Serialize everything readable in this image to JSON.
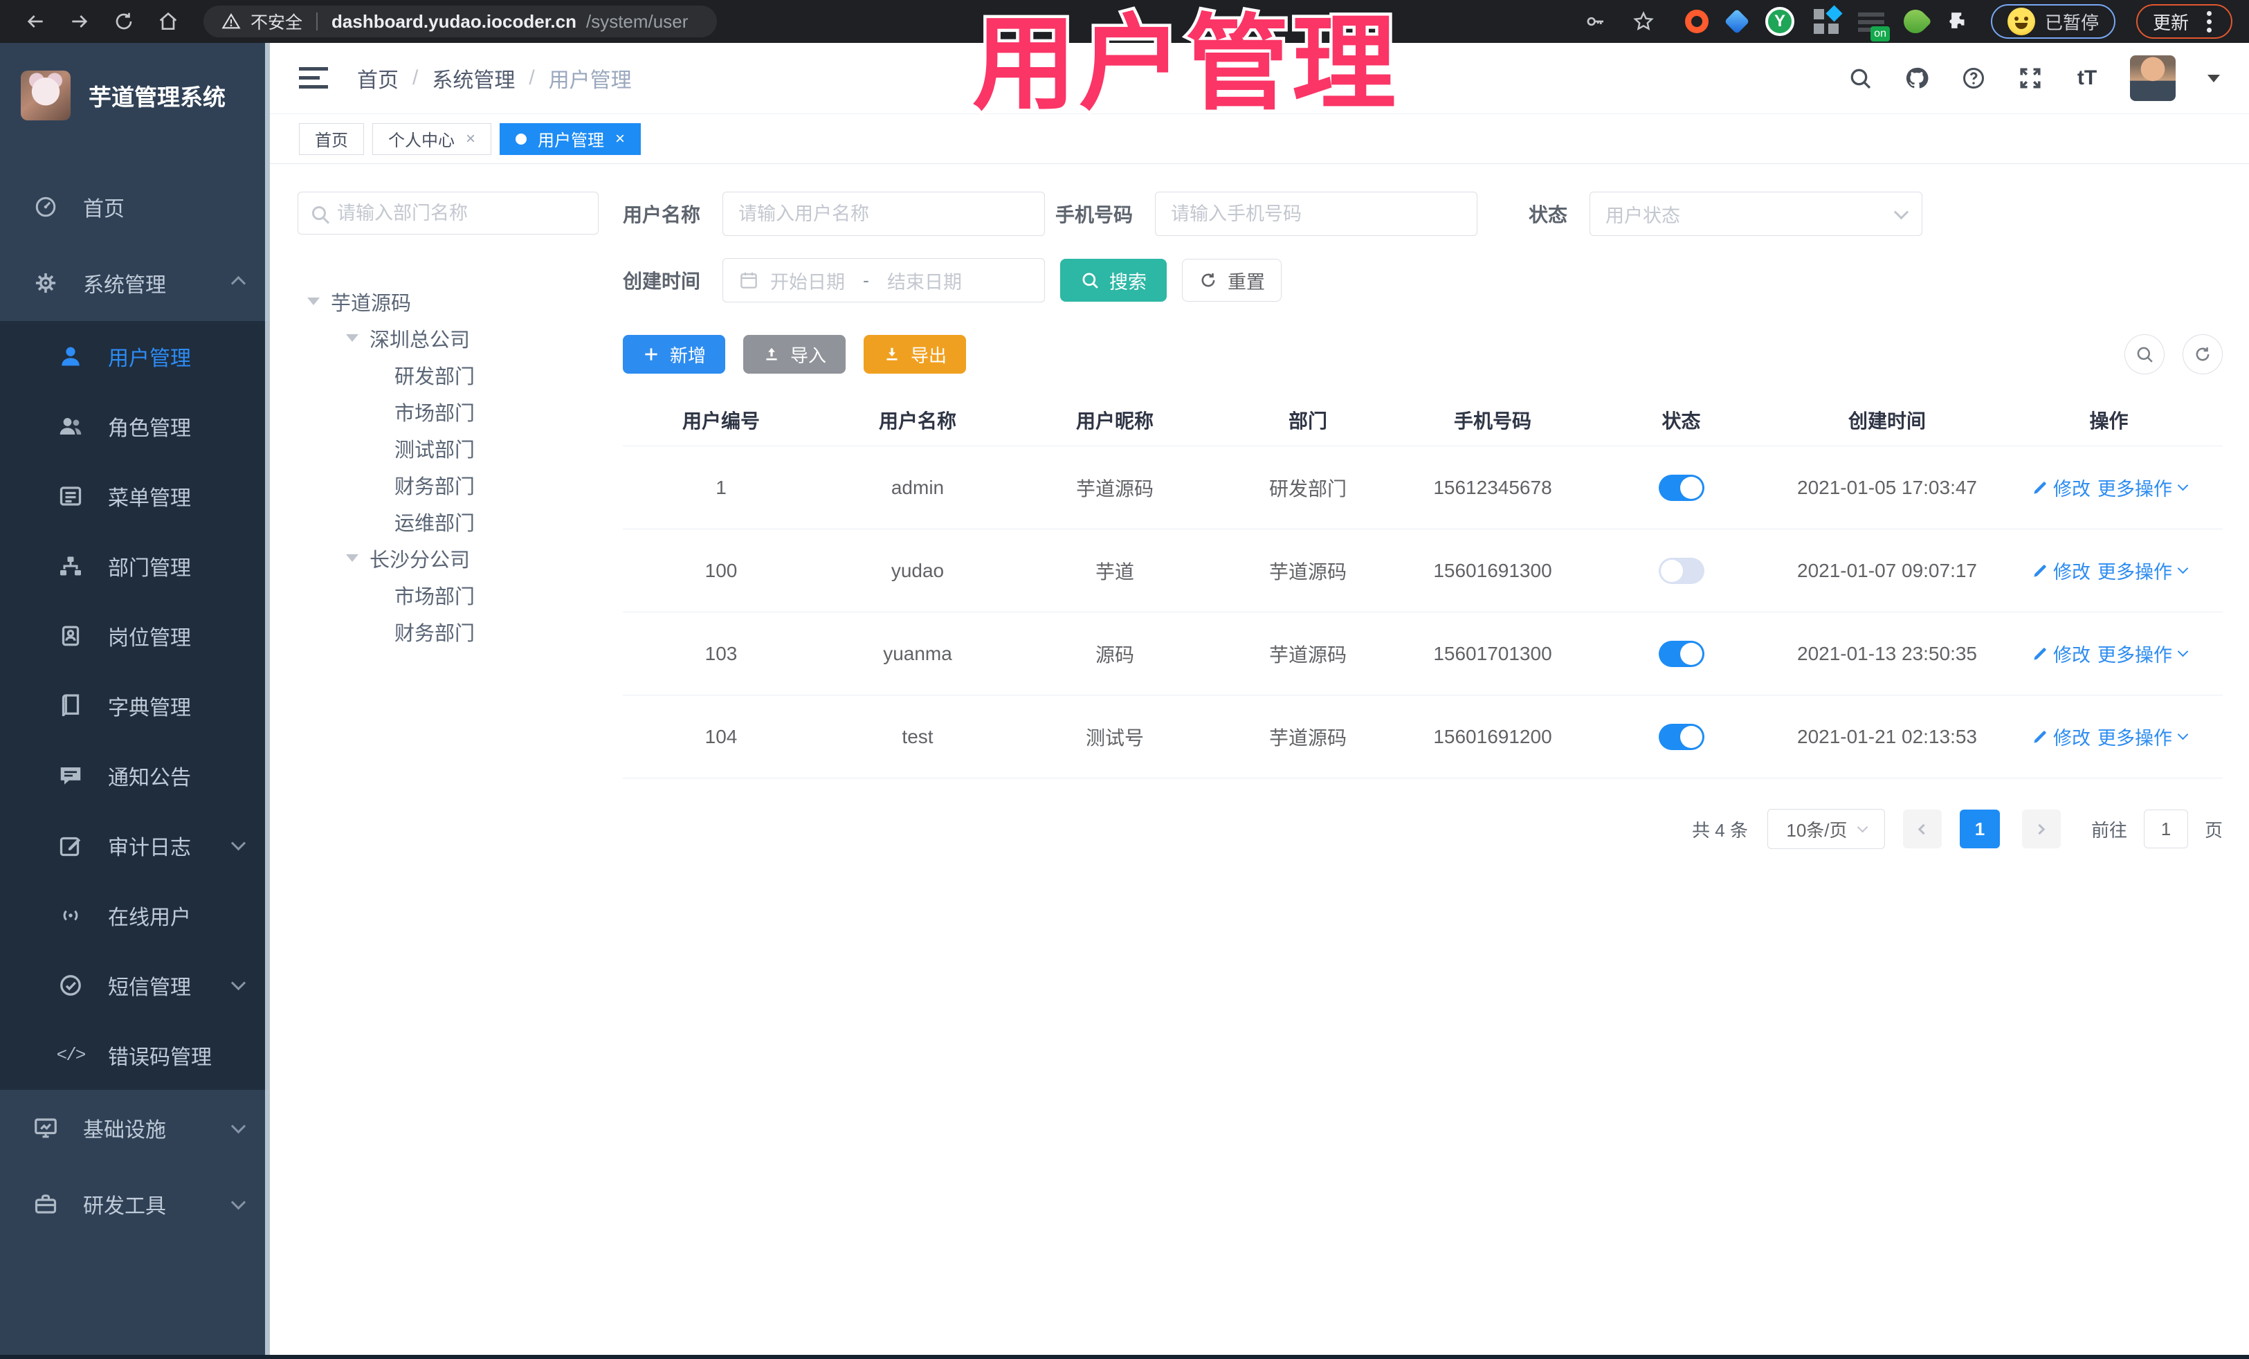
{
  "colors": {
    "primary": "#1d8cf5",
    "sidebar_bg": "#304156",
    "submenu_bg": "#1f2d3d",
    "teal_search": "#2db7a5",
    "export_orange": "#f0a020",
    "import_gray": "#909399",
    "overlay_pink": "#fb3566",
    "chrome_bg": "#1e2023"
  },
  "browser": {
    "security": "不安全",
    "url_host": "dashboard.yudao.iocoder.cn",
    "url_path": "/system/user",
    "paused": "已暂停",
    "update": "更新"
  },
  "overlay": {
    "title": "用户管理"
  },
  "sidebar": {
    "app_title": "芋道管理系统",
    "items": [
      {
        "label": "首页"
      },
      {
        "label": "系统管理"
      },
      {
        "label": "用户管理"
      },
      {
        "label": "角色管理"
      },
      {
        "label": "菜单管理"
      },
      {
        "label": "部门管理"
      },
      {
        "label": "岗位管理"
      },
      {
        "label": "字典管理"
      },
      {
        "label": "通知公告"
      },
      {
        "label": "审计日志"
      },
      {
        "label": "在线用户"
      },
      {
        "label": "短信管理"
      },
      {
        "label": "错误码管理"
      },
      {
        "label": "基础设施"
      },
      {
        "label": "研发工具"
      }
    ]
  },
  "header": {
    "breadcrumb": {
      "home": "首页",
      "section": "系统管理",
      "current": "用户管理",
      "separator": "/"
    }
  },
  "tabs": {
    "home": "首页",
    "profile": "个人中心",
    "user": "用户管理"
  },
  "dept": {
    "search_placeholder": "请输入部门名称",
    "tree": [
      {
        "label": "芋道源码"
      },
      {
        "label": "深圳总公司"
      },
      {
        "label": "研发部门"
      },
      {
        "label": "市场部门"
      },
      {
        "label": "测试部门"
      },
      {
        "label": "财务部门"
      },
      {
        "label": "运维部门"
      },
      {
        "label": "长沙分公司"
      },
      {
        "label": "市场部门"
      },
      {
        "label": "财务部门"
      }
    ]
  },
  "filters": {
    "username_label": "用户名称",
    "username_placeholder": "请输入用户名称",
    "mobile_label": "手机号码",
    "mobile_placeholder": "请输入手机号码",
    "status_label": "状态",
    "status_placeholder": "用户状态",
    "created_label": "创建时间",
    "date_start_placeholder": "开始日期",
    "date_separator": "-",
    "date_end_placeholder": "结束日期",
    "search": "搜索",
    "reset": "重置"
  },
  "toolbar": {
    "add": "新增",
    "import": "导入",
    "export": "导出"
  },
  "table": {
    "columns": [
      "用户编号",
      "用户名称",
      "用户昵称",
      "部门",
      "手机号码",
      "状态",
      "创建时间",
      "操作"
    ],
    "actions": {
      "edit": "修改",
      "more": "更多操作"
    },
    "rows": [
      {
        "id": "1",
        "username": "admin",
        "nickname": "芋道源码",
        "dept": "研发部门",
        "mobile": "15612345678",
        "status": "on",
        "created": "2021-01-05 17:03:47"
      },
      {
        "id": "100",
        "username": "yudao",
        "nickname": "芋道",
        "dept": "芋道源码",
        "mobile": "15601691300",
        "status": "off",
        "created": "2021-01-07 09:07:17"
      },
      {
        "id": "103",
        "username": "yuanma",
        "nickname": "源码",
        "dept": "芋道源码",
        "mobile": "15601701300",
        "status": "on",
        "created": "2021-01-13 23:50:35"
      },
      {
        "id": "104",
        "username": "test",
        "nickname": "测试号",
        "dept": "芋道源码",
        "mobile": "15601691200",
        "status": "on",
        "created": "2021-01-21 02:13:53"
      }
    ]
  },
  "pagination": {
    "total": "共 4 条",
    "page_size": "10条/页",
    "page": "1",
    "goto_label": "前往",
    "goto_value": "1",
    "unit": "页"
  }
}
